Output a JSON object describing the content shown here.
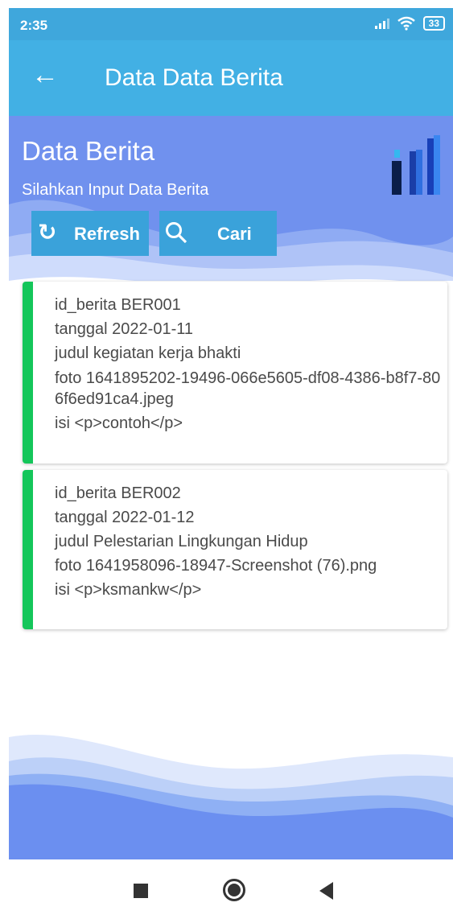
{
  "status": {
    "time": "2:35",
    "battery": "33"
  },
  "appbar": {
    "title": "Data Data Berita"
  },
  "hero": {
    "title": "Data Berita",
    "subtitle": "Silahkan Input Data Berita"
  },
  "buttons": {
    "refresh_label": "Refresh",
    "search_label": "Cari"
  },
  "cards": [
    {
      "id_berita": "id_berita BER001",
      "tanggal": "tanggal 2022-01-11",
      "judul": "judul kegiatan kerja bhakti",
      "foto": "foto 1641895202-19496-066e5605-df08-4386-b8f7-806f6ed91ca4.jpeg",
      "isi": "isi <p>contoh</p>"
    },
    {
      "id_berita": "id_berita BER002",
      "tanggal": "tanggal 2022-01-12",
      "judul": "judul Pelestarian Lingkungan Hidup",
      "foto": "foto 1641958096-18947-Screenshot (76).png",
      "isi": "isi <p>ksmankw</p>"
    }
  ],
  "colors": {
    "appbar": "#42b0e4",
    "hero": "#7091ee",
    "accent": "#14c65a",
    "button": "#3aa2da"
  }
}
